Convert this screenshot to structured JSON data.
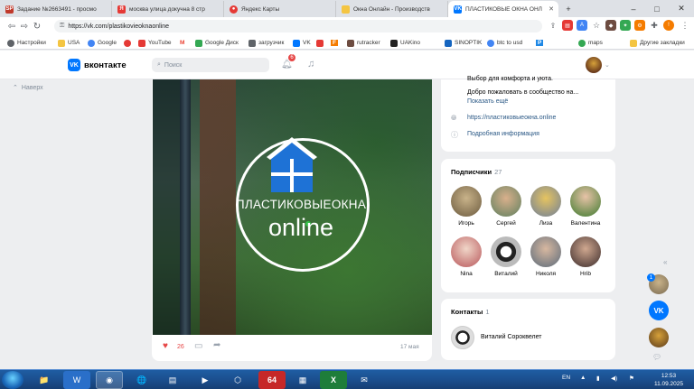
{
  "browser": {
    "tabs": [
      {
        "title": "Задание №2663491 - просмо",
        "favicon": "SP",
        "color": "#c0392b"
      },
      {
        "title": "москва улица докучна 8 стр",
        "favicon": "Я",
        "color": "#e53935"
      },
      {
        "title": "Яндекс Карты",
        "favicon": "●",
        "color": "#e53935"
      },
      {
        "title": "Окна Онлайн - Производств",
        "favicon": "",
        "color": "#f4c542"
      },
      {
        "title": "ПЛАСТИКОВЫЕ ОКНА ОНЛ",
        "favicon": "VK",
        "color": "#0077ff"
      }
    ],
    "url": "https://vk.com/plastikovieoknaonline",
    "window_controls": [
      "–",
      "□",
      "✕"
    ],
    "bookmarks": [
      {
        "label": "Настройки",
        "color": "#5f6368"
      },
      {
        "label": "USA",
        "color": "#f4c542"
      },
      {
        "label": "Google",
        "color": "#4285f4"
      },
      {
        "label": "",
        "color": "#e53935"
      },
      {
        "label": "YouTube",
        "color": "#e53935"
      },
      {
        "label": "M",
        "color": "#ea4335"
      },
      {
        "label": "Google Диск",
        "color": "#34a853"
      },
      {
        "label": "загрузчик",
        "color": "#5f6368"
      },
      {
        "label": "VK",
        "color": "#0077ff"
      },
      {
        "label": "",
        "color": "#e53935"
      },
      {
        "label": "F",
        "color": "#f57c00"
      },
      {
        "label": "rutracker",
        "color": "#6d4c41"
      },
      {
        "label": "UAKino",
        "color": "#222222"
      },
      {
        "label": "SINOPTIK",
        "color": "#1565c0"
      },
      {
        "label": "btc to usd",
        "color": "#4285f4"
      },
      {
        "label": "P",
        "color": "#1e88e5"
      },
      {
        "label": "maps",
        "color": "#34a853"
      },
      {
        "label": "Другие закладки",
        "color": "#f4c542"
      }
    ]
  },
  "vk": {
    "brand": "вконтакте",
    "logo": "VK",
    "search_placeholder": "Поиск",
    "notifications": "6",
    "back_label": "Наверх"
  },
  "post": {
    "logo_text": "ПЛАСТИКОВЫЕОКНА",
    "logo_online": "online",
    "likes": "26",
    "date": "17 мая"
  },
  "info": {
    "line1": "Выбор для комфорта и уюта.",
    "line2": "Добро пожаловать в сообщество на...",
    "show_more": "Показать ещё",
    "website": "https://пластиковыеокна.online",
    "details": "Подробная информация"
  },
  "subscribers": {
    "title": "Подписчики",
    "count": "27",
    "people": [
      {
        "name": "Игорь",
        "color": "#8a7a5a"
      },
      {
        "name": "Сергей",
        "color": "#6a8a6a"
      },
      {
        "name": "Лиза",
        "color": "#a58b3b"
      },
      {
        "name": "Валентина",
        "color": "#4c7d3a"
      },
      {
        "name": "Nina",
        "color": "#b8565a"
      },
      {
        "name": "Виталий",
        "color": "#444444"
      },
      {
        "name": "Николя",
        "color": "#5a6a7a"
      },
      {
        "name": "Hrib",
        "color": "#4a3a3a"
      }
    ]
  },
  "contacts": {
    "title": "Контакты",
    "count": "1",
    "name": "Виталий Сороквелет"
  },
  "sidebar_right": {
    "badge": "1"
  },
  "taskbar": {
    "apps": [
      "📁",
      "W",
      "◉",
      "🌐",
      "▤",
      "▶",
      "⬡",
      "⌂",
      "64",
      "▦",
      "X",
      "✉"
    ],
    "lang": "EN",
    "time": "12:53",
    "date": "11.09.2025"
  }
}
